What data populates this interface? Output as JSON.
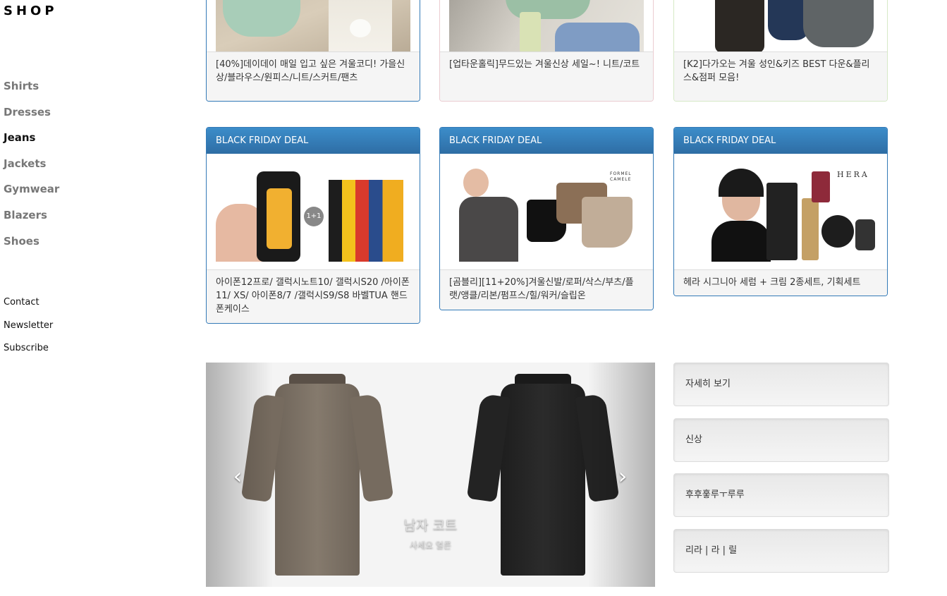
{
  "brand": "SHOP",
  "categories": [
    {
      "label": "Shirts",
      "active": false
    },
    {
      "label": "Dresses",
      "active": false
    },
    {
      "label": "Jeans",
      "active": true
    },
    {
      "label": "Jackets",
      "active": false
    },
    {
      "label": "Gymwear",
      "active": false
    },
    {
      "label": "Blazers",
      "active": false
    },
    {
      "label": "Shoes",
      "active": false
    }
  ],
  "links": [
    "Contact",
    "Newsletter",
    "Subscribe"
  ],
  "top_cards": [
    {
      "caption": "[40%]데이데이 매일 입고 싶은 겨울코디! 가을신상/블라우스/원피스/니트/스커트/팬츠"
    },
    {
      "caption": "[업타운홀릭]무드있는 겨울신상 세일~! 니트/코트"
    },
    {
      "caption": "[K2]다가오는 겨울 성인&키즈 BEST 다운&플리스&점퍼 모음!"
    }
  ],
  "deal_cards": [
    {
      "header": "BLACK FRIDAY DEAL",
      "badge": "1+1",
      "caption": "아이폰12프로/ 갤럭시노트10/ 갤럭시S20 /아이폰11/ XS/ 아이폰8/7 /갤럭시S9/S8 바벨TUA 핸드폰케이스"
    },
    {
      "header": "BLACK FRIDAY DEAL",
      "logo": "FORMEL CAMELE",
      "caption": "[곰블리][11+20%]겨울신발/로퍼/삭스/부츠/플랫/앵클/리본/펌프스/힐/워커/슬립온"
    },
    {
      "header": "BLACK FRIDAY DEAL",
      "logo": "HERA",
      "caption": "헤라 시그니아 세럼 + 크림 2종세트, 기획세트"
    }
  ],
  "carousel": {
    "title": "남자 코트",
    "subtitle": "사세요 얼른",
    "prev_icon": "chevron-left-icon",
    "next_icon": "chevron-right-icon"
  },
  "side_buttons": [
    "자세히 보기",
    "신상",
    "후후훟루ㅜ루루",
    "리라 | 라 | 릴"
  ],
  "colors": {
    "primary": "#337ab7",
    "success_border": "#d6e9c6",
    "danger_border": "#ebccd1"
  }
}
